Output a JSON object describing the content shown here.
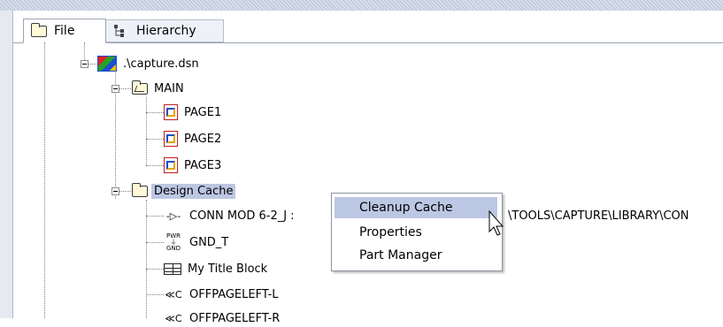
{
  "tabs": [
    {
      "label": "File",
      "icon": "folder-icon",
      "active": true
    },
    {
      "label": "Hierarchy",
      "icon": "hierarchy-icon",
      "active": false
    }
  ],
  "tree": {
    "design": ".\\capture.dsn",
    "main_folder": "MAIN",
    "pages": [
      "PAGE1",
      "PAGE2",
      "PAGE3"
    ],
    "cache_folder": "Design Cache",
    "cache_items": [
      {
        "label": "CONN MOD 6-2_J :",
        "icon": "connector-icon"
      },
      {
        "label": "GND_T",
        "icon": "power-ground-icon"
      },
      {
        "label": "My Title Block",
        "icon": "title-block-icon"
      },
      {
        "label": "OFFPAGELEFT-L",
        "icon": "offpage-connector-icon"
      },
      {
        "label": "OFFPAGELEFT-R",
        "icon": "offpage-connector-icon"
      }
    ],
    "path_tail": "\\TOOLS\\CAPTURE\\LIBRARY\\CON"
  },
  "context_menu": {
    "items": [
      "Cleanup Cache",
      "Properties",
      "Part Manager"
    ],
    "highlighted": "Cleanup Cache"
  },
  "colors": {
    "selection": "#bdc7e2",
    "menu_highlight": "#bcc7e3"
  }
}
